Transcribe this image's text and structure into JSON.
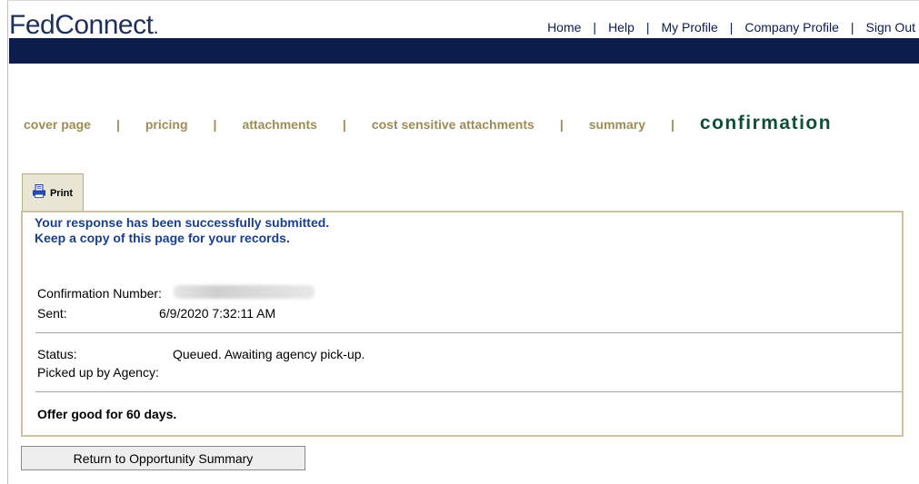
{
  "header": {
    "logo_text": "FedConnect",
    "logo_mark": ".",
    "nav": [
      "Home",
      "Help",
      "My Profile",
      "Company Profile",
      "Sign Out"
    ],
    "separator": "|"
  },
  "steps": {
    "items": [
      "cover page",
      "pricing",
      "attachments",
      "cost sensitive attachments",
      "summary"
    ],
    "active": "confirmation",
    "separator": "|"
  },
  "print_tab": {
    "label": "Print",
    "icon": "printer-icon"
  },
  "confirmation": {
    "message_line1": "Your response has been successfully submitted.",
    "message_line2": "Keep a copy of this page for your records.",
    "confirmation_number_label": "Confirmation Number:",
    "sent_label": "Sent:",
    "sent_value": "6/9/2020 7:32:11 AM",
    "status_label": "Status:",
    "status_value": "Queued. Awaiting agency pick-up.",
    "picked_up_label": "Picked up by Agency:",
    "offer_text": "Offer good for 60 days."
  },
  "return_button": "Return to Opportunity Summary",
  "colors": {
    "navy": "#0c1d4c",
    "gold": "#9c8c55",
    "active_green": "#0f4f32",
    "message_blue": "#1a3f8f"
  }
}
